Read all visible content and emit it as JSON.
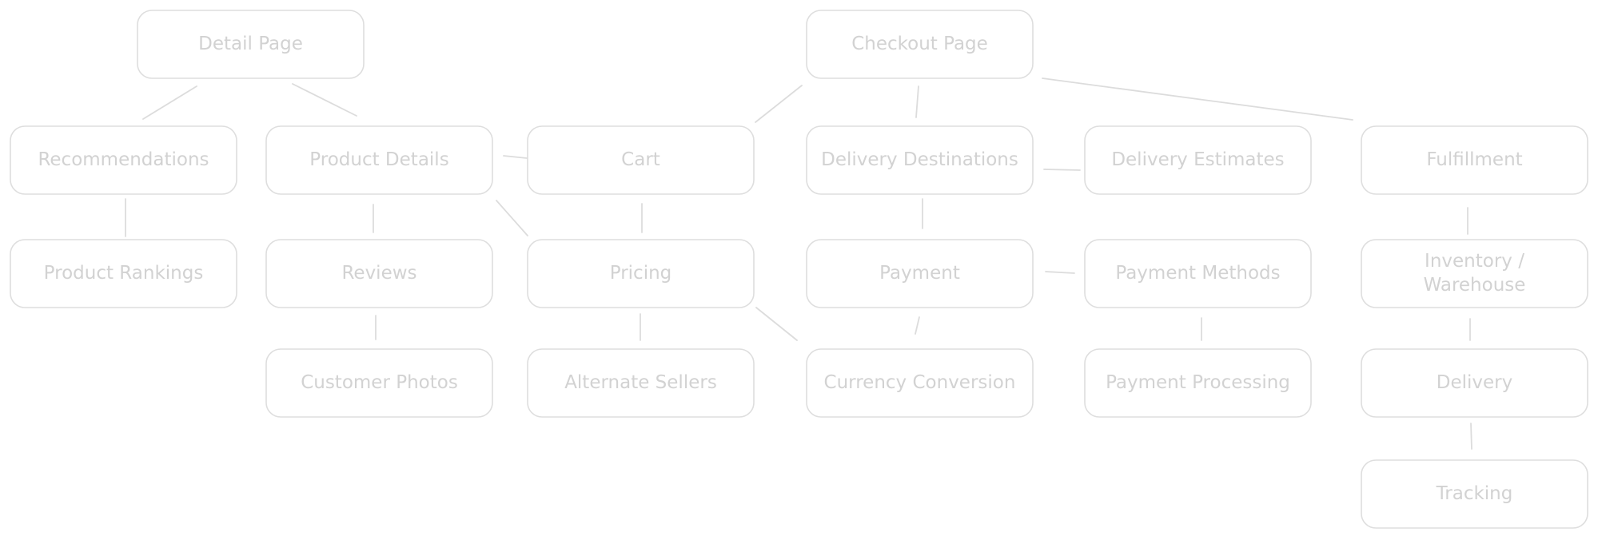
{
  "diagram": {
    "colors": {
      "stroke": "#dedede",
      "text": "#d2d2d2",
      "background": "#ffffff"
    },
    "nodes": [
      {
        "id": "detail-page",
        "label": "Detail Page"
      },
      {
        "id": "checkout-page",
        "label": "Checkout Page"
      },
      {
        "id": "recommendations",
        "label": "Recommendations"
      },
      {
        "id": "product-details",
        "label": "Product Details"
      },
      {
        "id": "cart",
        "label": "Cart"
      },
      {
        "id": "delivery-destinations",
        "label": "Delivery Destinations"
      },
      {
        "id": "delivery-estimates",
        "label": "Delivery Estimates"
      },
      {
        "id": "fulfillment",
        "label": "Fulfillment"
      },
      {
        "id": "product-rankings",
        "label": "Product Rankings"
      },
      {
        "id": "reviews",
        "label": "Reviews"
      },
      {
        "id": "pricing",
        "label": "Pricing"
      },
      {
        "id": "payment",
        "label": "Payment"
      },
      {
        "id": "payment-methods",
        "label": "Payment Methods"
      },
      {
        "id": "inventory-warehouse",
        "label": "Inventory / Warehouse",
        "lines": [
          "Inventory /",
          "Warehouse"
        ]
      },
      {
        "id": "customer-photos",
        "label": "Customer Photos"
      },
      {
        "id": "alternate-sellers",
        "label": "Alternate Sellers"
      },
      {
        "id": "currency-conversion",
        "label": "Currency Conversion"
      },
      {
        "id": "payment-processing",
        "label": "Payment Processing"
      },
      {
        "id": "delivery",
        "label": "Delivery"
      },
      {
        "id": "tracking",
        "label": "Tracking"
      }
    ],
    "edges": [
      [
        "detail-page",
        "recommendations"
      ],
      [
        "detail-page",
        "product-details"
      ],
      [
        "recommendations",
        "product-rankings"
      ],
      [
        "product-details",
        "cart"
      ],
      [
        "product-details",
        "reviews"
      ],
      [
        "product-details",
        "pricing"
      ],
      [
        "cart",
        "pricing"
      ],
      [
        "checkout-page",
        "cart"
      ],
      [
        "checkout-page",
        "delivery-destinations"
      ],
      [
        "checkout-page",
        "fulfillment"
      ],
      [
        "delivery-destinations",
        "delivery-estimates"
      ],
      [
        "delivery-destinations",
        "payment"
      ],
      [
        "reviews",
        "customer-photos"
      ],
      [
        "pricing",
        "alternate-sellers"
      ],
      [
        "pricing",
        "currency-conversion"
      ],
      [
        "payment",
        "currency-conversion"
      ],
      [
        "payment",
        "payment-methods"
      ],
      [
        "payment-methods",
        "payment-processing"
      ],
      [
        "fulfillment",
        "inventory-warehouse"
      ],
      [
        "inventory-warehouse",
        "delivery"
      ],
      [
        "delivery",
        "tracking"
      ]
    ]
  }
}
